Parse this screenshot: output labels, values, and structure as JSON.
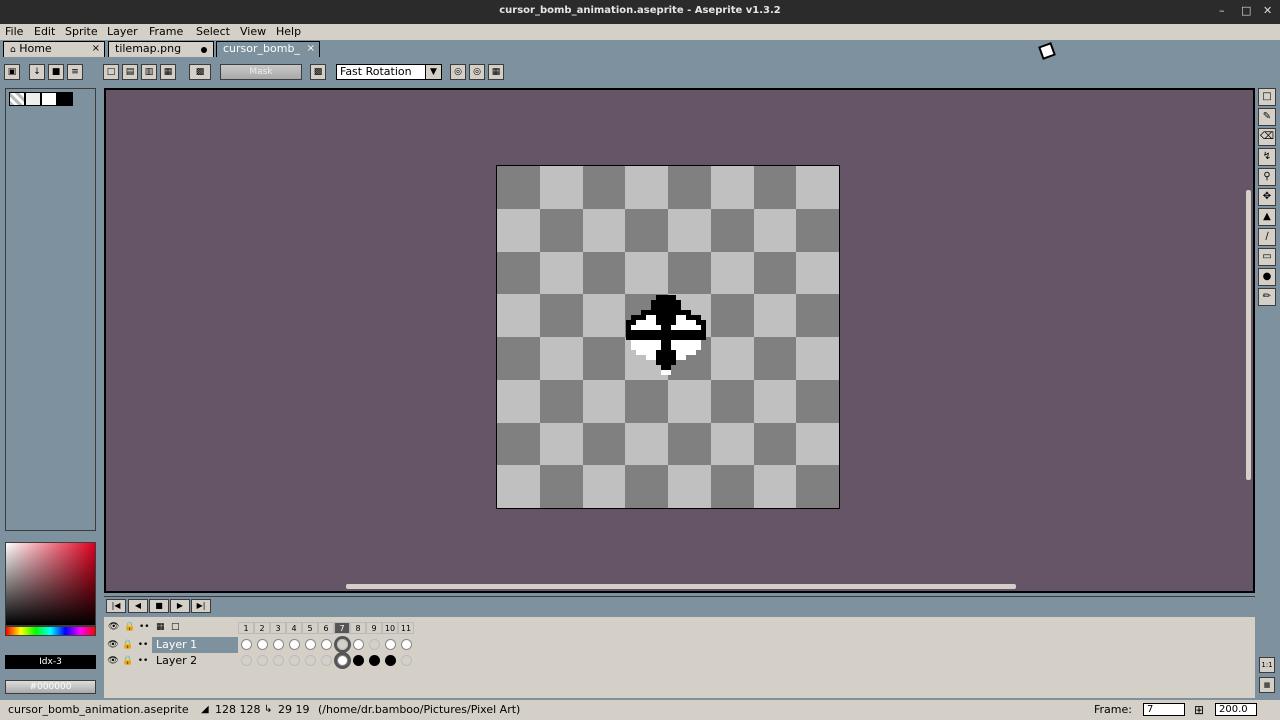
{
  "window": {
    "title": "cursor_bomb_animation.aseprite - Aseprite v1.3.2",
    "min": "–",
    "max": "□",
    "close": "✕"
  },
  "menu": [
    "File",
    "Edit",
    "Sprite",
    "Layer",
    "Frame",
    "Select",
    "View",
    "Help"
  ],
  "tabs": [
    {
      "label": "Home",
      "close": "×"
    },
    {
      "label": "tilemap.png"
    },
    {
      "label": "cursor_bomb_",
      "close": "×"
    }
  ],
  "toolbar": {
    "mask_label": "Mask",
    "rotation_value": "Fast Rotation"
  },
  "colors": {
    "bg": "#7d929e",
    "canvas_bg": "#665566",
    "check_dark": "#808080",
    "check_light": "#c0c0c0",
    "panel": "#d4d0c8"
  },
  "color_bar": {
    "index_label": "Idx-3",
    "hex_label": "#000000"
  },
  "timeline": {
    "frames": [
      "1",
      "2",
      "3",
      "4",
      "5",
      "6",
      "7",
      "8",
      "9",
      "10",
      "11"
    ],
    "current_frame": 7,
    "layers": [
      {
        "name": "Layer 1",
        "selected": true,
        "cels": [
          "full",
          "full",
          "full",
          "full",
          "full",
          "full",
          "empty",
          "full",
          "empty",
          "full",
          "full"
        ]
      },
      {
        "name": "Layer 2",
        "selected": false,
        "cels": [
          "empty",
          "empty",
          "empty",
          "empty",
          "empty",
          "empty",
          "full",
          "black",
          "black",
          "black",
          "empty"
        ]
      }
    ]
  },
  "status": {
    "filename": "cursor_bomb_animation.aseprite",
    "size": "128 128",
    "pos": "29 19",
    "path": "(/home/dr.bamboo/Pictures/Pixel Art)",
    "frame_label": "Frame:",
    "frame_value": "7",
    "zoom_value": "200.0"
  },
  "right_buttons": {
    "one_to_one": "1:1"
  }
}
